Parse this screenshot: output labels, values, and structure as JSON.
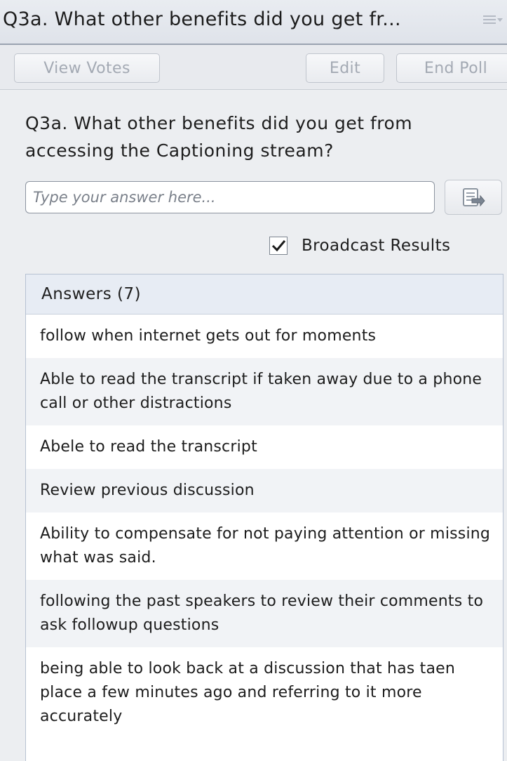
{
  "title_bar": {
    "title": "Q3a. What other benefits  did you get fr..."
  },
  "toolbar": {
    "view_votes_label": "View Votes",
    "edit_label": "Edit",
    "end_poll_label": "End Poll"
  },
  "poll": {
    "question": "Q3a. What other benefits  did you get from accessing the  Captioning stream?",
    "answer_placeholder": "Type your answer here...",
    "answer_value": "",
    "broadcast_label": "Broadcast Results",
    "broadcast_checked": true
  },
  "answers": {
    "header": "Answers (7)",
    "items": [
      "follow when internet gets out for moments",
      "Able to read the transcript  if  taken away due to a phone call or  other  distractions",
      "Abele to read the transcript",
      "Review previous discussion",
      "Ability to compensate for not paying attention or missing what was said.",
      "following the past speakers to review their comments to ask followup questions",
      "being able to look back at a discussion that has taen place a few minutes ago and referring to it more accurately"
    ]
  },
  "icons": {
    "pod_menu": "pod-menu-icon",
    "submit": "submit-answer-icon",
    "checkbox_check": "checkmark-icon"
  },
  "colors": {
    "title_bar_bg": "#dfe3ea",
    "panel_bg": "#eceef1",
    "answers_header_bg": "#e7ecf4",
    "alt_row_bg": "#f1f3f6",
    "disabled_text": "#a3a9b3"
  }
}
